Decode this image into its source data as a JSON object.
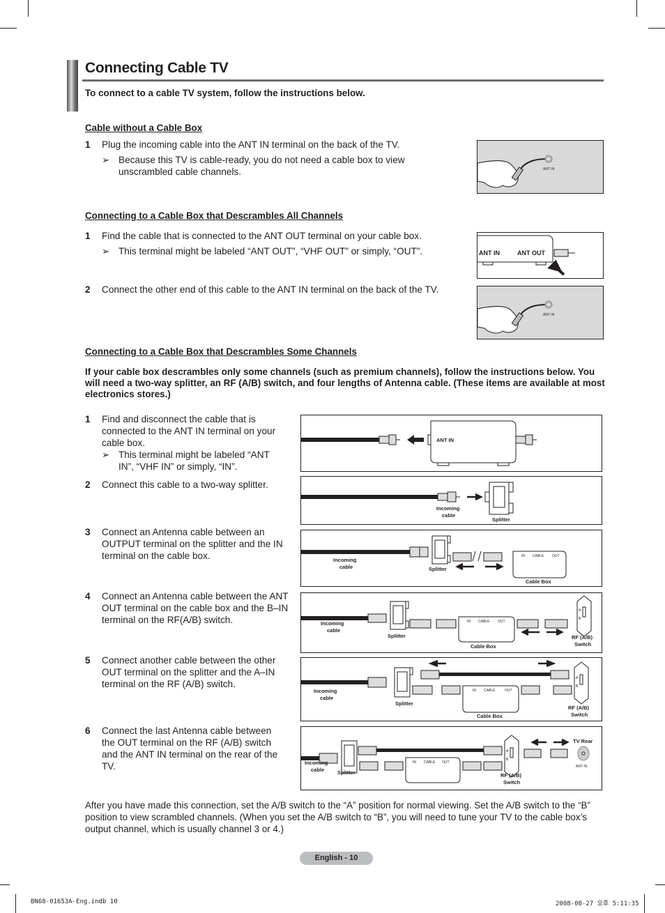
{
  "page": {
    "title": "Connecting Cable TV",
    "intro": "To connect to a cable TV system, follow the instructions below."
  },
  "section1": {
    "heading": "Cable without a Cable Box",
    "steps": [
      {
        "num": "1",
        "text": "Plug the incoming cable into the ANT IN terminal on the back of the TV.",
        "note": "Because this TV is cable-ready, you do not need a cable box to view unscrambled cable channels."
      }
    ],
    "figure": {
      "label": "ANT IN"
    }
  },
  "section2": {
    "heading": "Connecting to a Cable Box that Descrambles All Channels",
    "steps": [
      {
        "num": "1",
        "text": "Find the cable that is connected to the ANT OUT terminal on your cable box.",
        "note": "This terminal might be labeled “ANT OUT”, “VHF OUT” or simply, “OUT”."
      },
      {
        "num": "2",
        "text": "Connect the other end of this cable to the ANT IN terminal on the back of the TV."
      }
    ],
    "figure1": {
      "ant_in": "ANT IN",
      "ant_out": "ANT OUT"
    },
    "figure2": {
      "label": "ANT IN"
    }
  },
  "section3": {
    "heading": "Connecting to a Cable Box that Descrambles Some Channels",
    "intro": "If your cable box descrambles only some channels (such as premium channels), follow the instructions below. You will need a two-way splitter, an RF (A/B) switch, and four lengths of Antenna cable. (These items are available at most electronics stores.)",
    "steps": [
      {
        "num": "1",
        "text": "Find and disconnect the cable that is connected to the ANT IN terminal on your cable box.",
        "note": "This terminal might be labeled “ANT IN”, “VHF IN” or simply, “IN”."
      },
      {
        "num": "2",
        "text": "Connect this cable to a two-way splitter."
      },
      {
        "num": "3",
        "text": "Connect an Antenna cable between an OUTPUT terminal on the splitter and the IN terminal on the cable box."
      },
      {
        "num": "4",
        "text": "Connect an Antenna cable between the ANT OUT terminal on the cable box and the B–IN terminal on the RF(A/B) switch."
      },
      {
        "num": "5",
        "text": "Connect another cable between the other OUT terminal on the splitter and the A–IN terminal on the RF (A/B) switch."
      },
      {
        "num": "6",
        "text": "Connect the last Antenna cable between the OUT terminal on the RF (A/B) switch and the ANT IN terminal on the rear of the TV."
      }
    ],
    "labels": {
      "ant_in": "ANT IN",
      "incoming_cable_1": "Incoming",
      "incoming_cable_2": "cable",
      "splitter": "Splitter",
      "cable_box": "Cable Box",
      "rf_switch_1": "RF (A/B)",
      "rf_switch_2": "Switch",
      "tv_rear": "TV Rear",
      "box_in": "IN",
      "box_cable": "CABLE",
      "box_out": "OUT",
      "switch_a": "A",
      "switch_b": "B"
    },
    "closing": "After you have made this connection, set the A/B switch to the “A” position for normal viewing. Set the A/B switch to the “B” position to view scrambled channels. (When you set the A/B switch to “B”, you will need to tune your TV to the cable box’s output channel, which is usually channel 3 or 4.)"
  },
  "note_arrow": "➢",
  "page_number": "English - 10",
  "footer": {
    "file": "BN68-01653A-Eng.indb   10",
    "timestamp": "2008-08-27   오후 5:11:35"
  }
}
